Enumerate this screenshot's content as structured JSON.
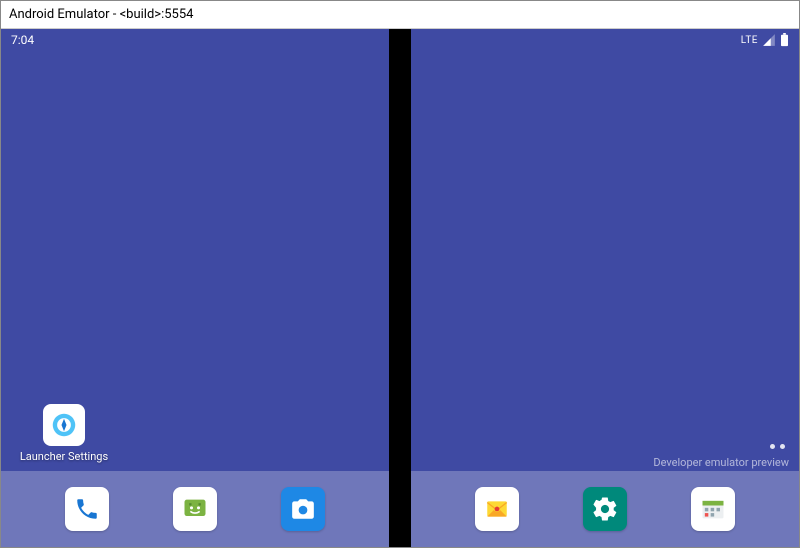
{
  "window": {
    "title": "Android Emulator - <build>:5554"
  },
  "status": {
    "time": "7:04",
    "network_label": "LTE"
  },
  "home": {
    "launcher_settings_label": "Launcher Settings",
    "preview_label": "Developer emulator preview"
  },
  "dock_left": [
    {
      "name": "phone"
    },
    {
      "name": "messages"
    },
    {
      "name": "camera"
    }
  ],
  "dock_right": [
    {
      "name": "mail"
    },
    {
      "name": "settings"
    },
    {
      "name": "calendar"
    }
  ],
  "colors": {
    "wallpaper": "#3f4aa3",
    "dock_overlay": "rgba(255,255,255,0.25)"
  }
}
